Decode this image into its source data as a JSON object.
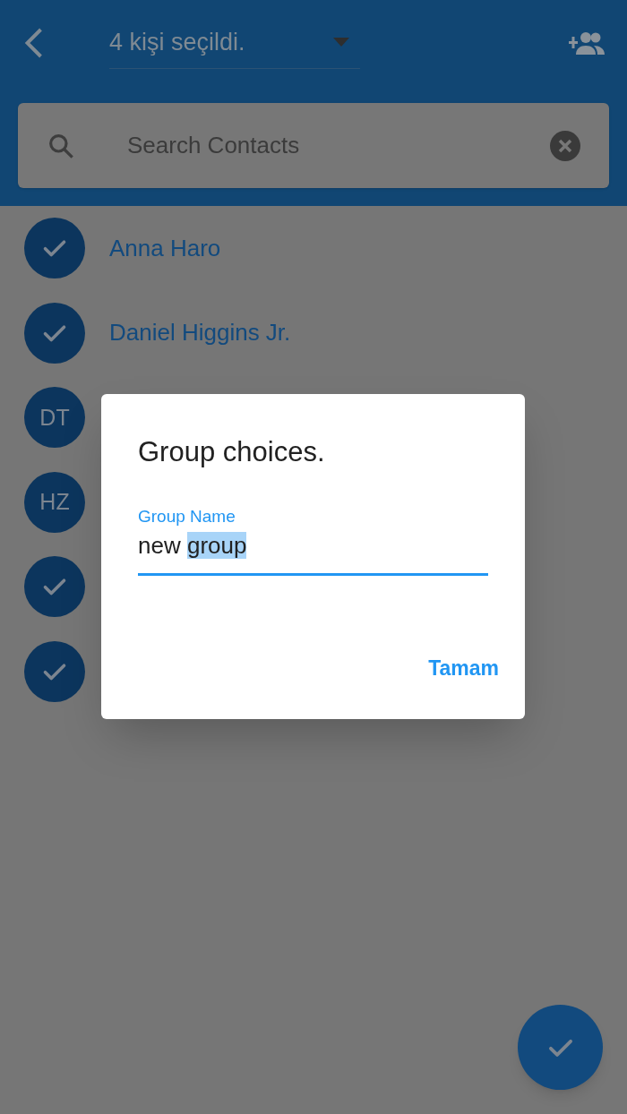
{
  "app_bar": {
    "title": "4 kişi seçildi."
  },
  "search": {
    "placeholder": "Search Contacts"
  },
  "contacts": [
    {
      "selected": true,
      "name": "Anna Haro"
    },
    {
      "selected": true,
      "name": "Daniel Higgins Jr."
    },
    {
      "selected": false,
      "initials": "DT"
    },
    {
      "selected": false,
      "initials": "HZ"
    },
    {
      "selected": true
    },
    {
      "selected": true
    }
  ],
  "dialog": {
    "title": "Group choices.",
    "field": {
      "label": "Group Name",
      "value_parts": [
        {
          "text": "new",
          "selected": false
        },
        {
          "text": "group",
          "selected": true
        }
      ]
    },
    "buttons": [
      "Tamam"
    ]
  }
}
